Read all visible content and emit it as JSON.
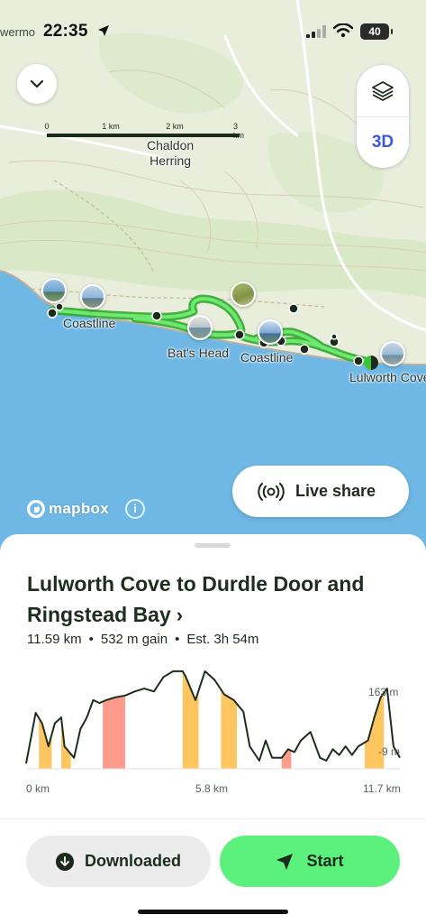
{
  "status_bar": {
    "time": "22:35",
    "place_fragment": "wermo",
    "battery": "40"
  },
  "map": {
    "scale_ticks": [
      "0",
      "1 km",
      "2 km",
      "3 km"
    ],
    "labels": {
      "chaldon_line1": "Chaldon",
      "chaldon_line2": "Herring",
      "coastline_west": "Coastline",
      "bats_head": "Bat's Head",
      "coastline_east": "Coastline",
      "lulworth": "Lulworth Cove"
    },
    "three_d_label": "3D",
    "attribution": "mapbox",
    "info_glyph": "i",
    "icons": [
      "chevron-down-icon",
      "layers-icon",
      "broadcast-icon",
      "info-icon"
    ]
  },
  "live_share": {
    "label": "Live share"
  },
  "route": {
    "title": "Lulworth Cove to Durdle Door and Ringstead Bay",
    "chevron": "›",
    "distance": "11.59 km",
    "gain": "532 m gain",
    "estimate": "Est. 3h 54m",
    "separator": "•"
  },
  "chart_data": {
    "type": "area",
    "title": "",
    "xlabel": "",
    "ylabel": "",
    "x_ticks": [
      "0 km",
      "5.8 km",
      "11.7 km"
    ],
    "y_ticks": [
      "163 m",
      "-9 m"
    ],
    "xlim": [
      0,
      11.7
    ],
    "ylim": [
      -9,
      163
    ],
    "x": [
      0.0,
      0.3,
      0.5,
      0.7,
      0.9,
      1.1,
      1.2,
      1.5,
      1.7,
      1.9,
      2.1,
      2.3,
      2.5,
      2.8,
      3.1,
      3.4,
      3.7,
      4.0,
      4.3,
      4.6,
      4.9,
      5.0,
      5.3,
      5.6,
      5.9,
      6.2,
      6.5,
      6.8,
      7.0,
      7.3,
      7.5,
      7.7,
      8.0,
      8.2,
      8.4,
      8.6,
      8.9,
      9.2,
      9.4,
      9.6,
      9.8,
      10.0,
      10.2,
      10.4,
      10.7,
      10.9,
      11.1,
      11.3,
      11.5,
      11.7
    ],
    "y": [
      0,
      88,
      70,
      30,
      70,
      80,
      30,
      10,
      60,
      80,
      110,
      105,
      110,
      115,
      118,
      125,
      130,
      125,
      150,
      160,
      160,
      150,
      110,
      160,
      145,
      120,
      110,
      90,
      30,
      5,
      40,
      10,
      10,
      25,
      20,
      40,
      55,
      10,
      5,
      25,
      15,
      30,
      15,
      30,
      40,
      80,
      115,
      130,
      30,
      10
    ],
    "series": [
      {
        "name": "",
        "color": "#1b2e1b"
      }
    ],
    "steep_sections": [
      {
        "start": 0.4,
        "end": 0.8,
        "grade": "moderate",
        "color": "#ffc561"
      },
      {
        "start": 1.1,
        "end": 1.4,
        "grade": "moderate",
        "color": "#ffc561"
      },
      {
        "start": 2.4,
        "end": 3.1,
        "grade": "steep",
        "color": "#ff9b8a"
      },
      {
        "start": 4.9,
        "end": 5.4,
        "grade": "moderate",
        "color": "#ffc561"
      },
      {
        "start": 6.1,
        "end": 6.6,
        "grade": "moderate",
        "color": "#ffc561"
      },
      {
        "start": 8.0,
        "end": 8.3,
        "grade": "steep",
        "color": "#ff9b8a"
      },
      {
        "start": 10.6,
        "end": 11.2,
        "grade": "moderate",
        "color": "#ffc561"
      }
    ],
    "grid": false
  },
  "actions": {
    "downloaded_label": "Downloaded",
    "start_label": "Start"
  },
  "colors": {
    "route_green": "#4bd24b",
    "start_button": "#5cf07d",
    "three_d_blue": "#3a5bd9",
    "sea": "#6fb8e6",
    "land": "#e8eddc"
  }
}
